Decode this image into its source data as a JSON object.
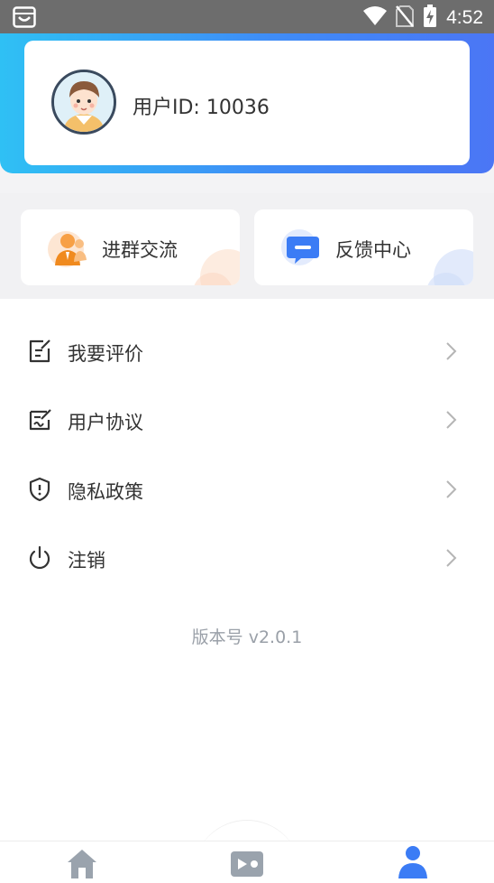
{
  "status_bar": {
    "time": "4:52",
    "icons": [
      "notification-icon",
      "wifi-icon",
      "no-sim-icon",
      "battery-charging-icon"
    ]
  },
  "profile": {
    "user_id_text": "用户ID: 10036",
    "avatar_icon": "avatar-icon"
  },
  "quick_actions": [
    {
      "label": "进群交流",
      "icon": "group-chat-icon"
    },
    {
      "label": "反馈中心",
      "icon": "feedback-icon"
    }
  ],
  "menu": {
    "items": [
      {
        "label": "我要评价",
        "icon": "edit-review-icon"
      },
      {
        "label": "用户协议",
        "icon": "agreement-icon"
      },
      {
        "label": "隐私政策",
        "icon": "shield-icon"
      },
      {
        "label": "注销",
        "icon": "power-icon"
      }
    ],
    "version": "版本号 v2.0.1"
  },
  "bottom_nav": [
    {
      "icon": "home-icon",
      "active": false
    },
    {
      "icon": "video-icon",
      "active": false
    },
    {
      "icon": "user-icon",
      "active": true
    }
  ],
  "colors": {
    "accent": "#3f8cf6",
    "header_start": "#2fc0f4",
    "header_end": "#4b76f5",
    "status_bar": "#6d6d6d",
    "version_text": "#9aa0a8"
  }
}
